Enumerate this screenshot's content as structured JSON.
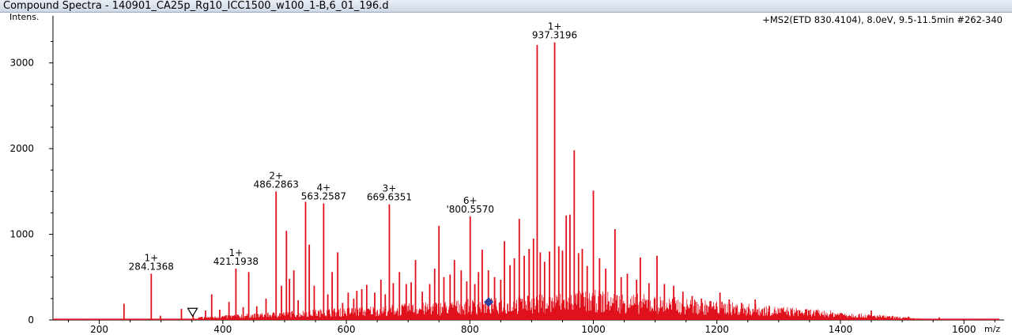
{
  "window": {
    "title": "Compound Spectra - 140901_CA25p_Rg10_ICC1500_w100_1-B,6_01_196.d"
  },
  "chart_data": {
    "type": "line",
    "title": "",
    "info": "+MS2(ETD 830.4104), 8.0eV, 9.5-11.5min #262-340",
    "xlabel": "m/z",
    "ylabel": "Intens.",
    "xlim": [
      125,
      1665
    ],
    "ylim": [
      0,
      3550
    ],
    "xticks": [
      200,
      400,
      600,
      800,
      1000,
      1200,
      1400,
      1600
    ],
    "yticks": [
      0,
      1000,
      2000,
      3000
    ],
    "grid": false,
    "series_color": "#e0101c",
    "peaks": [
      [
        240,
        190
      ],
      [
        284.1368,
        540
      ],
      [
        299,
        50
      ],
      [
        333,
        130
      ],
      [
        352,
        90
      ],
      [
        372,
        110
      ],
      [
        382,
        300
      ],
      [
        395,
        120
      ],
      [
        410,
        210
      ],
      [
        421.1938,
        600
      ],
      [
        433,
        150
      ],
      [
        442,
        560
      ],
      [
        455,
        160
      ],
      [
        470,
        250
      ],
      [
        486.2863,
        1500
      ],
      [
        495,
        400
      ],
      [
        503,
        1040
      ],
      [
        508,
        480
      ],
      [
        515,
        580
      ],
      [
        522,
        230
      ],
      [
        534,
        1380
      ],
      [
        540,
        880
      ],
      [
        548,
        400
      ],
      [
        563.2587,
        1360
      ],
      [
        570,
        300
      ],
      [
        577,
        560
      ],
      [
        586,
        790
      ],
      [
        594,
        200
      ],
      [
        603,
        320
      ],
      [
        612,
        250
      ],
      [
        617,
        340
      ],
      [
        625,
        360
      ],
      [
        633,
        410
      ],
      [
        646,
        320
      ],
      [
        656,
        470
      ],
      [
        663,
        300
      ],
      [
        669.6351,
        1350
      ],
      [
        676,
        430
      ],
      [
        686,
        560
      ],
      [
        697,
        420
      ],
      [
        705,
        440
      ],
      [
        712,
        700
      ],
      [
        723,
        330
      ],
      [
        735,
        420
      ],
      [
        743,
        600
      ],
      [
        750,
        1100
      ],
      [
        758,
        500
      ],
      [
        768,
        530
      ],
      [
        775,
        700
      ],
      [
        786,
        580
      ],
      [
        795,
        450
      ],
      [
        800.557,
        1210
      ],
      [
        808,
        420
      ],
      [
        814,
        560
      ],
      [
        820,
        820
      ],
      [
        830,
        580
      ],
      [
        840,
        500
      ],
      [
        850,
        470
      ],
      [
        856,
        920
      ],
      [
        865,
        640
      ],
      [
        872,
        720
      ],
      [
        880,
        1180
      ],
      [
        888,
        750
      ],
      [
        896,
        830
      ],
      [
        903,
        950
      ],
      [
        909,
        3210
      ],
      [
        914,
        790
      ],
      [
        921,
        680
      ],
      [
        929,
        800
      ],
      [
        937.3196,
        3240
      ],
      [
        944,
        860
      ],
      [
        950,
        810
      ],
      [
        956,
        1220
      ],
      [
        962,
        1230
      ],
      [
        969,
        1980
      ],
      [
        976,
        780
      ],
      [
        982,
        830
      ],
      [
        990,
        630
      ],
      [
        1000,
        1510
      ],
      [
        1010,
        720
      ],
      [
        1020,
        600
      ],
      [
        1035,
        1060
      ],
      [
        1045,
        500
      ],
      [
        1055,
        540
      ],
      [
        1070,
        470
      ],
      [
        1076,
        730
      ],
      [
        1090,
        430
      ],
      [
        1103,
        750
      ],
      [
        1115,
        420
      ],
      [
        1130,
        400
      ],
      [
        1145,
        330
      ],
      [
        1160,
        280
      ],
      [
        1175,
        250
      ],
      [
        1190,
        220
      ],
      [
        1205,
        320
      ],
      [
        1220,
        240
      ],
      [
        1240,
        200
      ],
      [
        1262,
        240
      ],
      [
        1285,
        160
      ],
      [
        1305,
        130
      ],
      [
        1330,
        110
      ],
      [
        1360,
        90
      ],
      [
        1400,
        80
      ],
      [
        1430,
        60
      ],
      [
        1450,
        110
      ],
      [
        1470,
        50
      ],
      [
        1510,
        40
      ],
      [
        1560,
        30
      ]
    ],
    "annotations": [
      {
        "mz": 284.1368,
        "charge": "1+",
        "label": "284.1368"
      },
      {
        "mz": 421.1938,
        "charge": "1+",
        "label": "421.1938"
      },
      {
        "mz": 486.2863,
        "charge": "2+",
        "label": "486.2863"
      },
      {
        "mz": 563.2587,
        "charge": "4+",
        "label": "563.2587"
      },
      {
        "mz": 669.6351,
        "charge": "3+",
        "label": "669.6351"
      },
      {
        "mz": 800.557,
        "charge": "6+",
        "label": "'800.5570"
      },
      {
        "mz": 937.3196,
        "charge": "1+",
        "label": "937.3196"
      }
    ],
    "markers": [
      {
        "type": "triangle-down",
        "mz": 351,
        "intensity": 90
      },
      {
        "type": "diamond",
        "mz": 830.4104,
        "intensity": 210,
        "color": "#2a3f9f"
      }
    ]
  }
}
